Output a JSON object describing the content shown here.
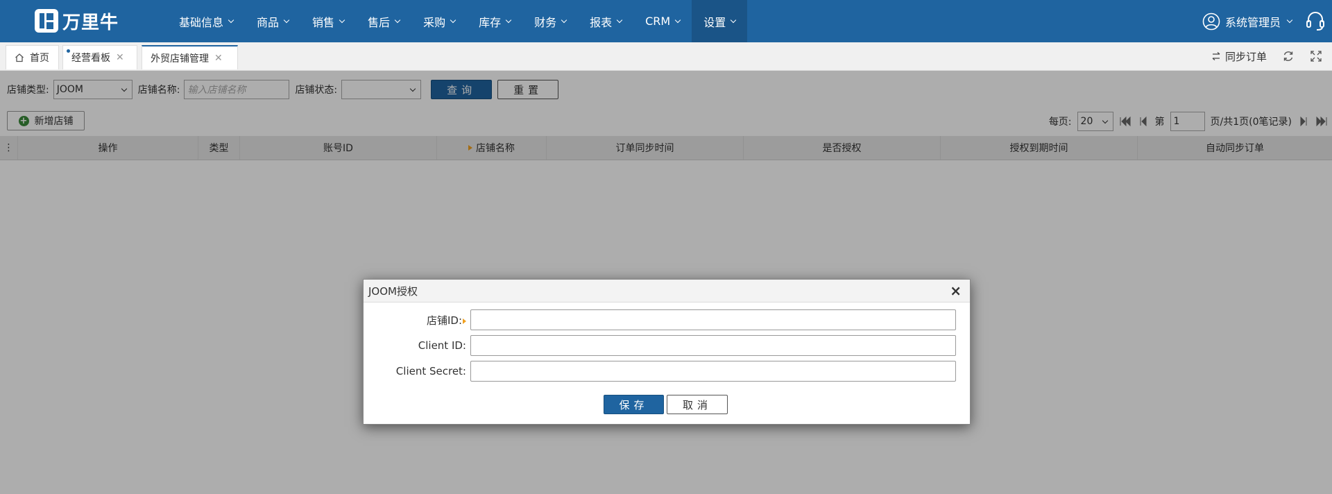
{
  "app": {
    "logo_text": "万里牛"
  },
  "nav": {
    "items": [
      {
        "label": "基础信息"
      },
      {
        "label": "商品"
      },
      {
        "label": "销售"
      },
      {
        "label": "售后"
      },
      {
        "label": "采购"
      },
      {
        "label": "库存"
      },
      {
        "label": "财务"
      },
      {
        "label": "报表"
      },
      {
        "label": "CRM"
      },
      {
        "label": "设置"
      }
    ],
    "user_name": "系统管理员"
  },
  "tabs": {
    "items": [
      {
        "label": "首页"
      },
      {
        "label": "经营看板"
      },
      {
        "label": "外贸店铺管理"
      }
    ],
    "sync_label": "同步订单"
  },
  "filter": {
    "store_type_label": "店铺类型:",
    "store_type_value": "JOOM",
    "store_name_label": "店铺名称:",
    "store_name_placeholder": "输入店铺名称",
    "store_status_label": "店铺状态:",
    "store_status_value": "",
    "query_label": "查询",
    "reset_label": "重置"
  },
  "toolbar": {
    "add_store_label": "新增店铺"
  },
  "pager": {
    "per_page_label": "每页:",
    "per_page_value": "20",
    "page_prefix": "第",
    "page_value": "1",
    "page_suffix": "页/共1页(0笔记录)"
  },
  "grid": {
    "columns": [
      "操作",
      "类型",
      "账号ID",
      "店铺名称",
      "订单同步时间",
      "是否授权",
      "授权到期时间",
      "自动同步订单"
    ]
  },
  "modal": {
    "title": "JOOM授权",
    "store_id_label": "店铺ID:",
    "client_id_label": "Client ID:",
    "client_secret_label": "Client Secret:",
    "store_id_value": "",
    "client_id_value": "",
    "client_secret_value": "",
    "save_label": "保存",
    "cancel_label": "取消",
    "close_glyph": "×"
  },
  "colors": {
    "brand": "#1f64a0",
    "required_marker": "#f0a020"
  }
}
